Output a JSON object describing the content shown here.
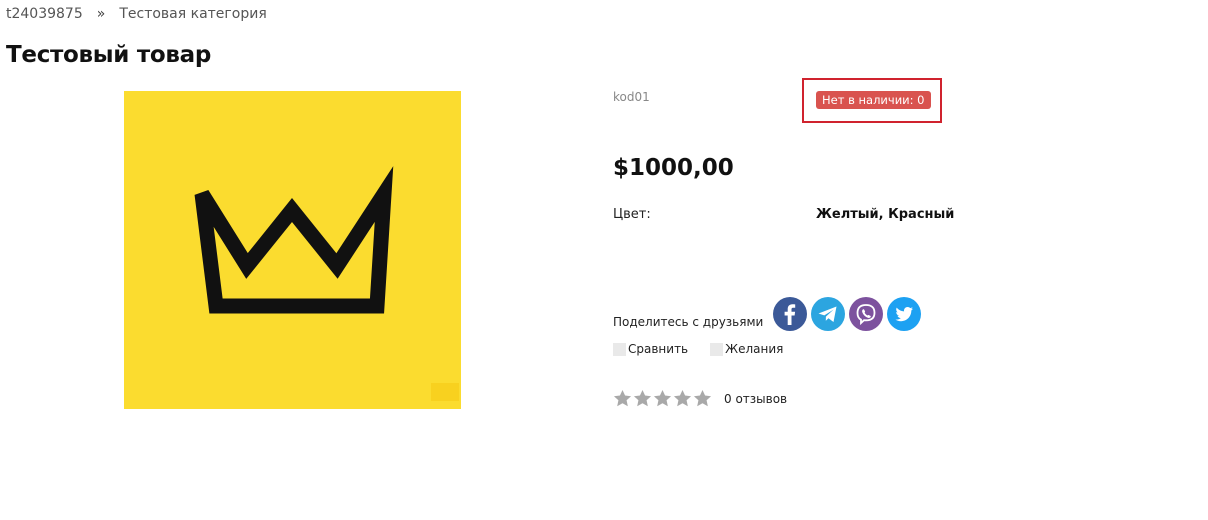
{
  "breadcrumb": {
    "home": "t24039875",
    "separator": "»",
    "category": "Тестовая категория"
  },
  "product": {
    "title": "Тестовый товар",
    "sku": "kod01",
    "stock_badge": "Нет в наличии: 0",
    "price": "$1000,00",
    "attribute_label": "Цвет:",
    "attribute_value": "Желтый, Красный",
    "image_bg_color": "#fbdc2f"
  },
  "share": {
    "label": "Поделитесь с друзьями",
    "networks": [
      "facebook-icon",
      "telegram-icon",
      "viber-icon",
      "twitter-icon"
    ],
    "colors": {
      "facebook": "#3b5998",
      "telegram": "#2ca5e0",
      "viber": "#7d529e",
      "twitter": "#1da1f2"
    }
  },
  "actions": {
    "compare": "Сравнить",
    "wishlist": "Желания"
  },
  "rating": {
    "stars_filled": 0,
    "stars_total": 5,
    "reviews": "0 отзывов"
  },
  "colors": {
    "stock_badge_bg": "#d9534f",
    "highlight_border": "#d0232e",
    "star_empty": "#a9a9a9"
  }
}
